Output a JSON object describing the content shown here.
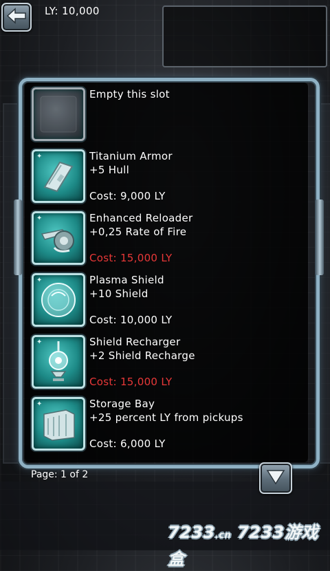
{
  "header": {
    "back_icon": "back-arrow-icon",
    "ly_balance": "LY: 10,000"
  },
  "colors": {
    "accent_teal": "#2aa7a3",
    "affordable_cost": "#ffffff",
    "unaffordable_cost": "#e83838",
    "frame": "#8fb1c4"
  },
  "empty_slot": {
    "label": "Empty this slot",
    "icon": "empty-slot-icon"
  },
  "items": [
    {
      "name": "Titanium Armor",
      "stat": "+5 Hull",
      "cost": "Cost: 9,000 LY",
      "affordable": true,
      "icon": "armor-plate-icon"
    },
    {
      "name": "Enhanced Reloader",
      "stat": "+0,25 Rate of Fire",
      "cost": "Cost: 15,000 LY",
      "affordable": false,
      "icon": "reloader-icon"
    },
    {
      "name": "Plasma Shield",
      "stat": "+10 Shield",
      "cost": "Cost: 10,000 LY",
      "affordable": true,
      "icon": "plasma-shield-icon"
    },
    {
      "name": "Shield Recharger",
      "stat": "+2 Shield Recharge",
      "cost": "Cost: 15,000 LY",
      "affordable": false,
      "icon": "shield-recharger-icon"
    },
    {
      "name": "Storage Bay",
      "stat": "+25 percent LY from pickups",
      "cost": "Cost: 6,000 LY",
      "affordable": true,
      "icon": "storage-bay-icon"
    }
  ],
  "footer": {
    "page_indicator": "Page: 1 of 2",
    "next_icon": "down-arrow-icon"
  },
  "watermark": {
    "text_a": "7233",
    "text_b": ".cn",
    "text_c": "7233游戏盒"
  }
}
